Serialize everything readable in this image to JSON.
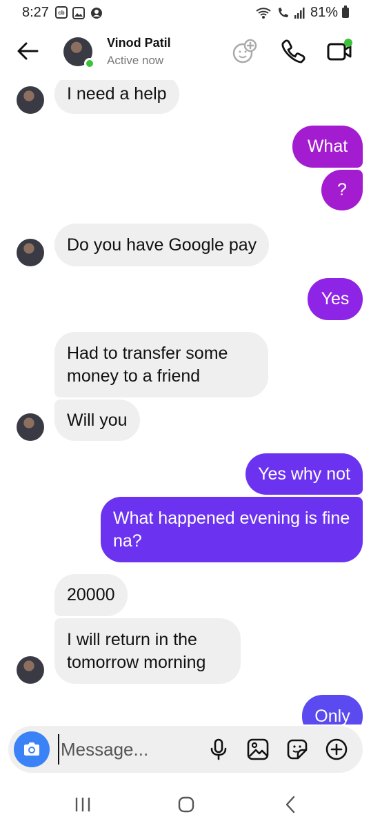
{
  "status_bar": {
    "time": "8:27",
    "left_icons": [
      "cb-icon",
      "gallery-icon",
      "account-icon"
    ],
    "battery": "81%"
  },
  "header": {
    "name": "Vinod Patil",
    "status": "Active now"
  },
  "messages": [
    {
      "dir": "in",
      "text": "I need a help"
    },
    {
      "dir": "out",
      "text": "What",
      "color": "#a31ccf"
    },
    {
      "dir": "out",
      "text": "?",
      "color": "#a31ccf"
    },
    {
      "dir": "in",
      "text": "Do you have Google pay"
    },
    {
      "dir": "out",
      "text": "Yes",
      "color": "#8e24e5"
    },
    {
      "dir": "in",
      "text": "Had to transfer some money to a friend"
    },
    {
      "dir": "in",
      "text": "Will you"
    },
    {
      "dir": "out",
      "text": "Yes why not",
      "color": "#6b33f0"
    },
    {
      "dir": "out",
      "text": "What happened evening is fine na?",
      "color": "#6b33f0"
    },
    {
      "dir": "in",
      "text": "20000"
    },
    {
      "dir": "in",
      "text": "I will return in the tomorrow morning"
    },
    {
      "dir": "out",
      "text": "Only",
      "color": "#5b4af0"
    }
  ],
  "composer": {
    "placeholder": "Message..."
  },
  "colors": {
    "accent_camera": "#3b82f6",
    "online": "#3cc13b",
    "incoming_bubble": "#efefef"
  }
}
